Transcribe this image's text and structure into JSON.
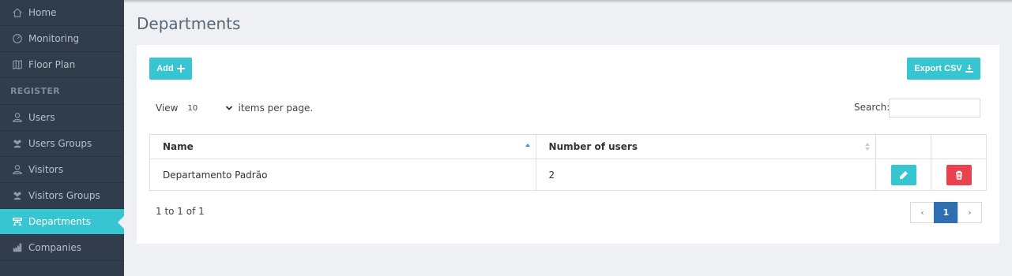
{
  "sidebar": {
    "items": [
      {
        "label": "Home",
        "icon": "home-icon"
      },
      {
        "label": "Monitoring",
        "icon": "gauge-icon"
      },
      {
        "label": "Floor Plan",
        "icon": "map-icon"
      }
    ],
    "section_label": "REGISTER",
    "register_items": [
      {
        "label": "Users",
        "icon": "user-icon"
      },
      {
        "label": "Users Groups",
        "icon": "users-group-icon"
      },
      {
        "label": "Visitors",
        "icon": "user-icon"
      },
      {
        "label": "Visitors Groups",
        "icon": "users-group-icon"
      },
      {
        "label": "Departments",
        "icon": "sitemap-icon",
        "active": true
      },
      {
        "label": "Companies",
        "icon": "chart-icon"
      }
    ]
  },
  "page": {
    "title": "Departments",
    "add_label": "Add",
    "export_label": "Export CSV",
    "view_label": "View",
    "per_page_value": "10",
    "per_page_suffix": "items per page.",
    "search_label": "Search:",
    "search_value": ""
  },
  "table": {
    "headers": [
      "Name",
      "Number of users"
    ],
    "rows": [
      {
        "name": "Departamento Padrão",
        "users": "2"
      }
    ]
  },
  "footer": {
    "count_text": "1 to 1 of 1",
    "prev": "‹",
    "current_page": "1",
    "next": "›"
  },
  "colors": {
    "accent": "#38c5d2",
    "sidebar_bg": "#323d4b",
    "danger": "#e8424e",
    "page_active": "#2f6fb0"
  }
}
